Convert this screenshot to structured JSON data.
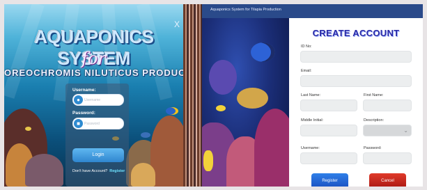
{
  "login": {
    "title_main": "AQUAPONICS SYSTEM",
    "title_for": "for",
    "title_sub": "OREOCHROMIS NILUTICUS PRODUCTION",
    "close_glyph": "X",
    "username_label": "Username:",
    "username_placeholder": "Username",
    "password_label": "Password:",
    "password_placeholder": "Password",
    "login_button": "Login",
    "no_account_text": "Don't have Account?",
    "register_link": "Register"
  },
  "register": {
    "window_title": "Aquaponics System for Tilapia Production",
    "heading": "CREATE ACCOUNT",
    "id_label": "ID No:",
    "email_label": "Email:",
    "last_name_label": "Last Name:",
    "first_name_label": "First Name:",
    "middle_initial_label": "Middle Initial:",
    "description_label": "Description:",
    "username_label": "Username:",
    "password_label": "Password:",
    "register_button": "Register",
    "cancel_button": "Cancel"
  },
  "icons": {
    "username": "user-icon",
    "password": "lock-icon",
    "description": "chevron-down-icon"
  },
  "colors": {
    "heading": "#2a2aa6",
    "register_button": "#2f7fe8",
    "cancel_button": "#e03a2a",
    "login_button": "#3a95dc"
  }
}
